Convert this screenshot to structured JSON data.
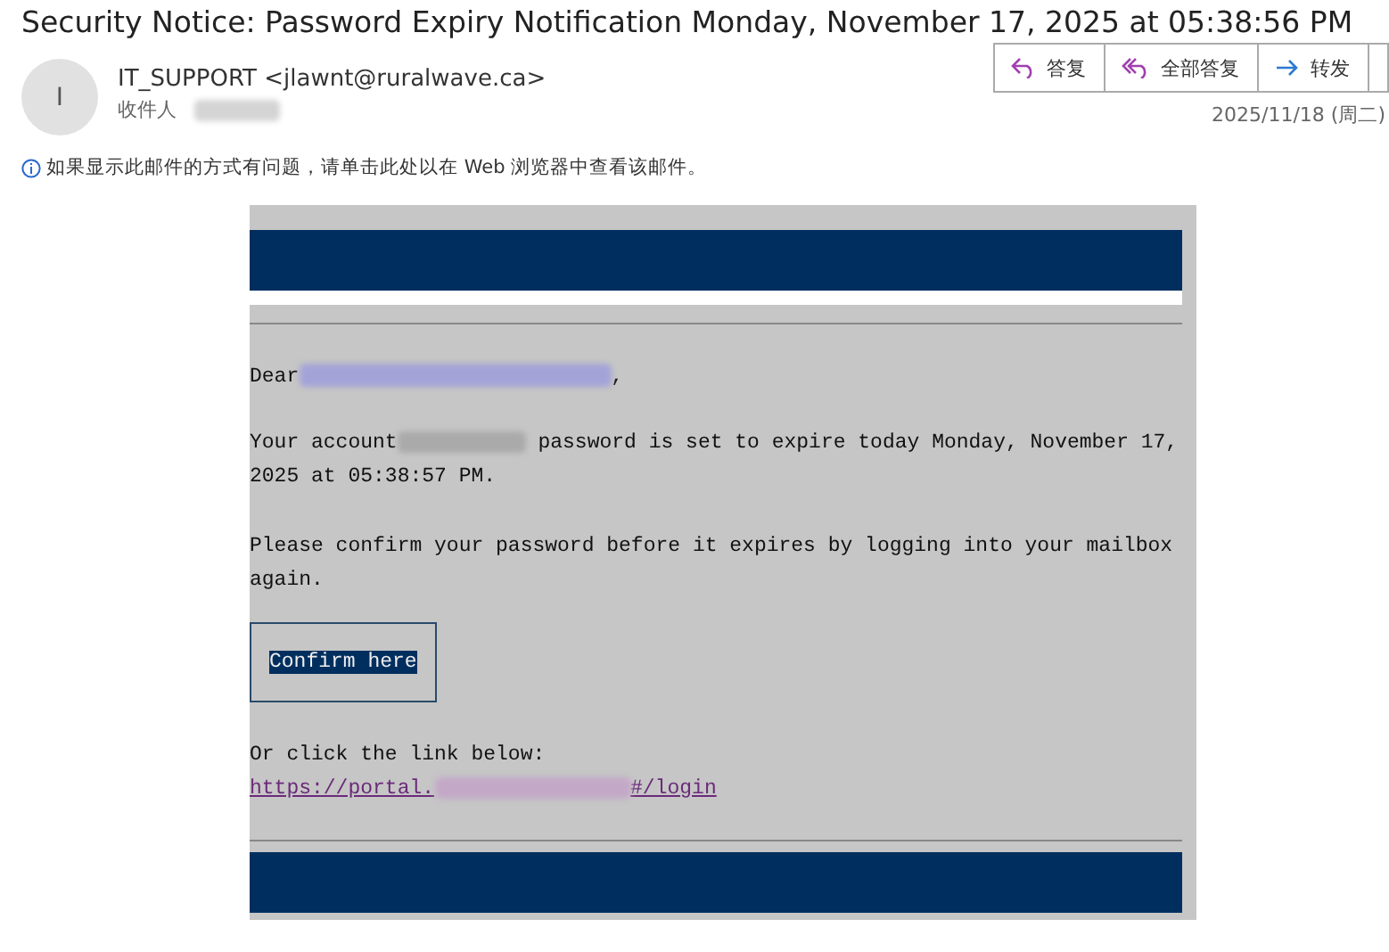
{
  "subject": "Security Notice: Password Expiry Notification Monday, November 17, 2025 at 05:38:56 PM",
  "sender": {
    "avatar_letter": "I",
    "from": "IT_SUPPORT <jlawnt@ruralwave.ca>",
    "to_label": "收件人"
  },
  "actions": [
    {
      "kind": "reply",
      "label": "答复"
    },
    {
      "kind": "reply_all",
      "label": "全部答复"
    },
    {
      "kind": "forward",
      "label": "转发"
    },
    {
      "kind": "more"
    }
  ],
  "date": "2025/11/18 (周二)",
  "info_bar": "如果显示此邮件的方式有问题，请单击此处以在 Web 浏览器中查看该邮件。",
  "body": {
    "greeting": "Dear",
    "greeting_end": ",",
    "account_before": "Your account",
    "account_after": " password is set to expire today Monday, November 17,",
    "account_after_2": "2025 at 05:38:57 PM.",
    "confirm_text": "Please confirm your password before it expires by logging into your mailbox again.",
    "button": "Confirm here",
    "link_intro": "Or click the link below:",
    "link_start": "https://portal.",
    "link_end": "#/login"
  }
}
